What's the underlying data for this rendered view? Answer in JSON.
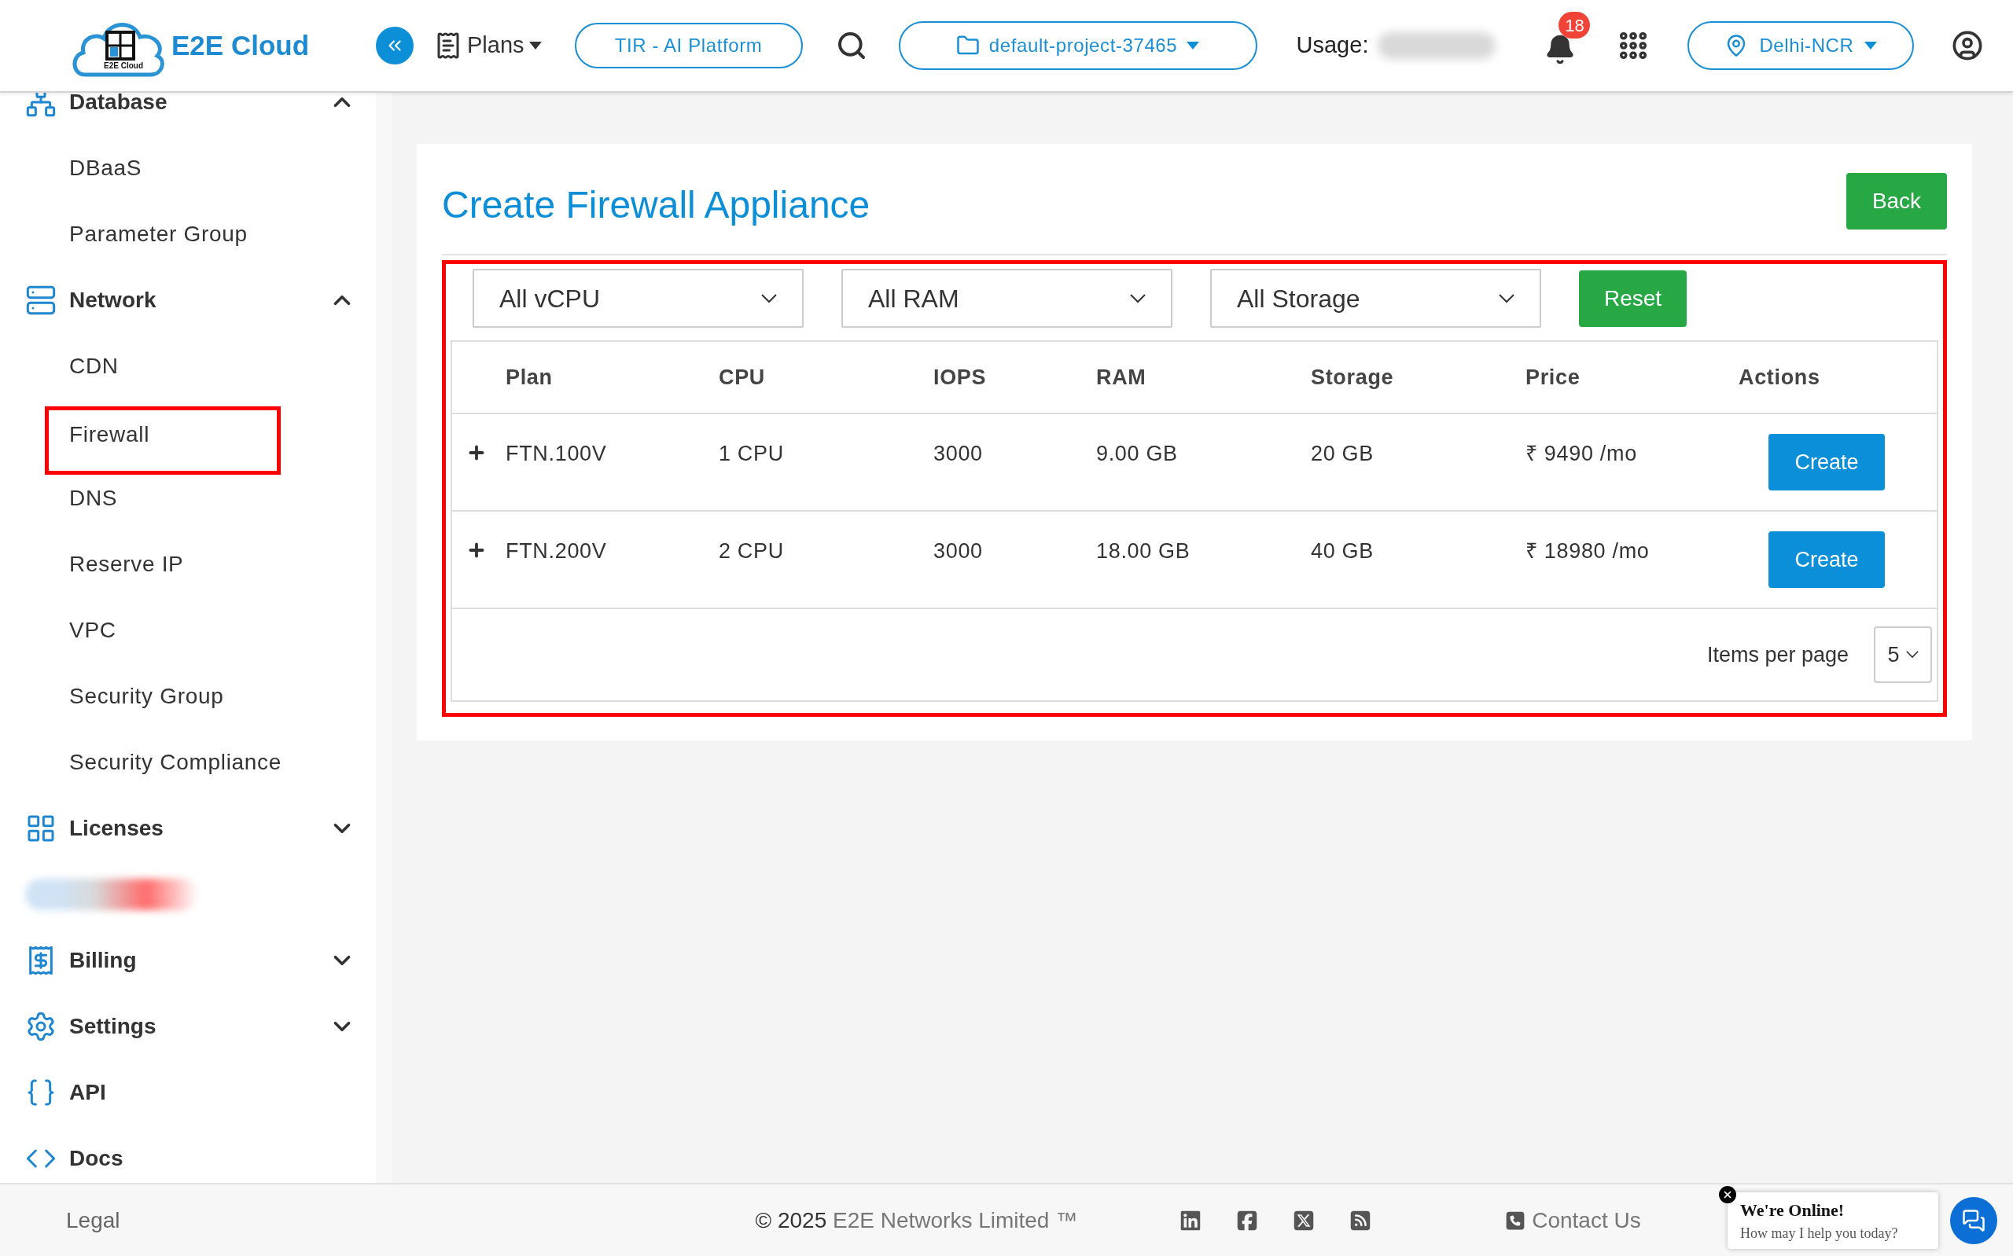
{
  "header": {
    "brand": "E2E Cloud",
    "logo_caption": "E2E Cloud",
    "plans_menu": "Plans",
    "platform_button": "TIR - AI Platform",
    "project_selector": "default-project-37465",
    "usage_label": "Usage:",
    "notification_count": "18",
    "region_selector": "Delhi-NCR"
  },
  "sidebar": {
    "items": [
      {
        "kind": "group",
        "label": "Database",
        "expanded": true,
        "children": [
          {
            "label": "DBaaS",
            "highlighted": false
          },
          {
            "label": "Parameter Group",
            "highlighted": false
          }
        ]
      },
      {
        "kind": "group",
        "label": "Network",
        "expanded": true,
        "children": [
          {
            "label": "CDN",
            "highlighted": false
          },
          {
            "label": "Firewall",
            "highlighted": true
          },
          {
            "label": "DNS",
            "highlighted": false
          },
          {
            "label": "Reserve IP",
            "highlighted": false
          },
          {
            "label": "VPC",
            "highlighted": false
          },
          {
            "label": "Security Group",
            "highlighted": false
          },
          {
            "label": "Security Compliance",
            "highlighted": false
          }
        ]
      },
      {
        "kind": "group",
        "label": "Licenses",
        "expanded": false
      },
      {
        "kind": "redacted"
      },
      {
        "kind": "group",
        "label": "Billing",
        "expanded": false
      },
      {
        "kind": "group",
        "label": "Settings",
        "expanded": false
      },
      {
        "kind": "link",
        "label": "API"
      },
      {
        "kind": "link",
        "label": "Docs"
      }
    ]
  },
  "page": {
    "title": "Create Firewall Appliance",
    "back_button": "Back",
    "filters": [
      "All vCPU",
      "All RAM",
      "All Storage"
    ],
    "reset_button": "Reset",
    "table": {
      "columns": [
        "Plan",
        "CPU",
        "IOPS",
        "RAM",
        "Storage",
        "Price",
        "Actions"
      ],
      "rows": [
        {
          "plan": "FTN.100V",
          "cpu": "1 CPU",
          "iops": "3000",
          "ram": "9.00 GB",
          "storage": "20 GB",
          "price": "₹ 9490 /mo",
          "action": "Create"
        },
        {
          "plan": "FTN.200V",
          "cpu": "2 CPU",
          "iops": "3000",
          "ram": "18.00 GB",
          "storage": "40 GB",
          "price": "₹ 18980 /mo",
          "action": "Create"
        }
      ]
    },
    "pagination": {
      "label": "Items per page",
      "page_size": "5"
    }
  },
  "footer": {
    "legal": "Legal",
    "copyright": "© 2025",
    "company": "E2E Networks Limited ™",
    "contact": "Contact Us"
  },
  "chat": {
    "title": "We're Online!",
    "subtitle": "How may I help you today?"
  }
}
